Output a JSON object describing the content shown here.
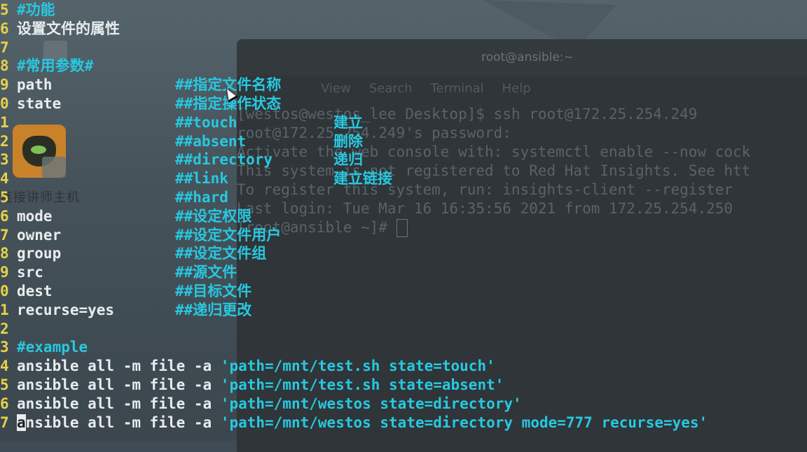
{
  "desktop": {
    "icon_label": "连接讲师主机"
  },
  "terminal": {
    "title": "root@ansible:~",
    "menu": [
      "View",
      "Search",
      "Terminal",
      "Help"
    ],
    "lines": [
      "[westos@westos_lee Desktop]$ ssh root@172.25.254.249",
      "root@172.25.254.249's password:",
      "Activate the web console with: systemctl enable --now cock",
      "",
      "This system is not registered to Red Hat Insights. See htt",
      "To register this system, run: insights-client --register",
      "",
      "Last login: Tue Mar 16 16:35:56 2021 from 172.25.254.250",
      "[root@ansible ~]# "
    ]
  },
  "editor": {
    "lines": [
      {
        "num": "5",
        "key": "",
        "comment": "#功能",
        "desc": ""
      },
      {
        "num": "6",
        "key": "设置文件的属性",
        "comment": "",
        "desc": ""
      },
      {
        "num": "7",
        "key": "",
        "comment": "",
        "desc": ""
      },
      {
        "num": "8",
        "key": "",
        "comment": "#常用参数#",
        "desc": ""
      },
      {
        "num": "9",
        "key": "path",
        "comment": "##指定文件名称",
        "desc": ""
      },
      {
        "num": "0",
        "key": "state",
        "comment": "##指定操作状态",
        "desc": ""
      },
      {
        "num": "1",
        "key": "",
        "comment": "##touch",
        "desc": "建立"
      },
      {
        "num": "2",
        "key": "",
        "comment": "##absent",
        "desc": "删除"
      },
      {
        "num": "3",
        "key": "",
        "comment": "##directory",
        "desc": "递归"
      },
      {
        "num": "4",
        "key": "",
        "comment": "##link",
        "desc": "建立链接"
      },
      {
        "num": "5",
        "key": "",
        "comment": "##hard",
        "desc": ""
      },
      {
        "num": "6",
        "key": "mode",
        "comment": "##设定权限",
        "desc": ""
      },
      {
        "num": "7",
        "key": "owner",
        "comment": "##设定文件用户",
        "desc": ""
      },
      {
        "num": "8",
        "key": "group",
        "comment": "##设定文件组",
        "desc": ""
      },
      {
        "num": "9",
        "key": "src",
        "comment": "##源文件",
        "desc": ""
      },
      {
        "num": "0",
        "key": "dest",
        "comment": "##目标文件",
        "desc": ""
      },
      {
        "num": "1",
        "key": "recurse=yes",
        "comment": "##递归更改",
        "desc": ""
      },
      {
        "num": "2",
        "key": "",
        "comment": "",
        "desc": ""
      },
      {
        "num": "3",
        "key": "",
        "comment": "#example",
        "desc": ""
      }
    ],
    "commands": [
      {
        "num": "4",
        "prefix": "ansible all -m file -a ",
        "arg": "'path=/mnt/test.sh state=touch'"
      },
      {
        "num": "5",
        "prefix": "ansible all -m file -a ",
        "arg": "'path=/mnt/test.sh state=absent'"
      },
      {
        "num": "6",
        "prefix": "ansible all -m file -a ",
        "arg": "'path=/mnt/westos state=directory'"
      },
      {
        "num": "7",
        "prefix": "nsible all -m file -a ",
        "cursor_char": "a",
        "arg": "'path=/mnt/westos state=directory mode=777 recurse=yes'"
      }
    ]
  }
}
